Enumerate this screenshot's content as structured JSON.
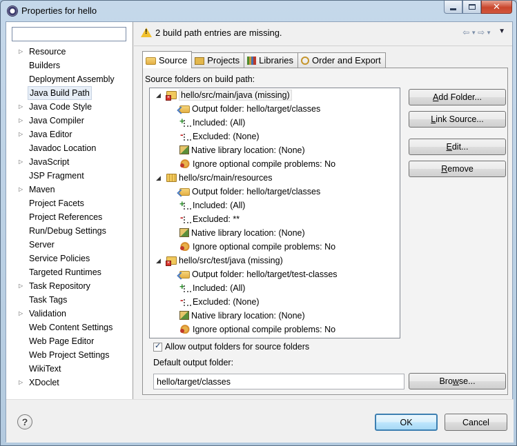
{
  "window": {
    "title": "Properties for hello",
    "buttons": {
      "minimize": "minimize",
      "maximize": "maximize",
      "close": "x"
    }
  },
  "sidebar": {
    "filter_placeholder": "",
    "items": [
      {
        "label": "Resource",
        "expandable": true
      },
      {
        "label": "Builders",
        "expandable": false
      },
      {
        "label": "Deployment Assembly",
        "expandable": false
      },
      {
        "label": "Java Build Path",
        "expandable": false,
        "selected": true
      },
      {
        "label": "Java Code Style",
        "expandable": true
      },
      {
        "label": "Java Compiler",
        "expandable": true
      },
      {
        "label": "Java Editor",
        "expandable": true
      },
      {
        "label": "Javadoc Location",
        "expandable": false
      },
      {
        "label": "JavaScript",
        "expandable": true
      },
      {
        "label": "JSP Fragment",
        "expandable": false
      },
      {
        "label": "Maven",
        "expandable": true
      },
      {
        "label": "Project Facets",
        "expandable": false
      },
      {
        "label": "Project References",
        "expandable": false
      },
      {
        "label": "Run/Debug Settings",
        "expandable": false
      },
      {
        "label": "Server",
        "expandable": false
      },
      {
        "label": "Service Policies",
        "expandable": false
      },
      {
        "label": "Targeted Runtimes",
        "expandable": false
      },
      {
        "label": "Task Repository",
        "expandable": true
      },
      {
        "label": "Task Tags",
        "expandable": false
      },
      {
        "label": "Validation",
        "expandable": true
      },
      {
        "label": "Web Content Settings",
        "expandable": false
      },
      {
        "label": "Web Page Editor",
        "expandable": false
      },
      {
        "label": "Web Project Settings",
        "expandable": false
      },
      {
        "label": "WikiText",
        "expandable": false
      },
      {
        "label": "XDoclet",
        "expandable": true
      }
    ]
  },
  "message": {
    "text": "2 build path entries are missing.",
    "icon": "warning-icon"
  },
  "tabs": [
    {
      "label": "Source",
      "icon": "source-folder-icon",
      "active": true
    },
    {
      "label": "Projects",
      "icon": "projects-icon",
      "active": false
    },
    {
      "label": "Libraries",
      "icon": "libraries-icon",
      "active": false
    },
    {
      "label": "Order and Export",
      "icon": "order-export-icon",
      "active": false
    }
  ],
  "source": {
    "label": "Source folders on build path:",
    "folders": [
      {
        "name": "hello/src/main/java (missing)",
        "missing": true,
        "children": [
          {
            "icon": "output-folder-icon",
            "text": "Output folder: hello/target/classes"
          },
          {
            "icon": "included-icon",
            "text": "Included: (All)"
          },
          {
            "icon": "excluded-icon",
            "text": "Excluded: (None)"
          },
          {
            "icon": "native-library-icon",
            "text": "Native library location: (None)"
          },
          {
            "icon": "ignore-problems-icon",
            "text": "Ignore optional compile problems: No"
          }
        ]
      },
      {
        "name": "hello/src/main/resources",
        "missing": false,
        "children": [
          {
            "icon": "output-folder-icon",
            "text": "Output folder: hello/target/classes"
          },
          {
            "icon": "included-icon",
            "text": "Included: (All)"
          },
          {
            "icon": "excluded-icon",
            "text": "Excluded: **"
          },
          {
            "icon": "native-library-icon",
            "text": "Native library location: (None)"
          },
          {
            "icon": "ignore-problems-icon",
            "text": "Ignore optional compile problems: No"
          }
        ]
      },
      {
        "name": "hello/src/test/java (missing)",
        "missing": true,
        "children": [
          {
            "icon": "output-folder-icon",
            "text": "Output folder: hello/target/test-classes"
          },
          {
            "icon": "included-icon",
            "text": "Included: (All)"
          },
          {
            "icon": "excluded-icon",
            "text": "Excluded: (None)"
          },
          {
            "icon": "native-library-icon",
            "text": "Native library location: (None)"
          },
          {
            "icon": "ignore-problems-icon",
            "text": "Ignore optional compile problems: No"
          }
        ]
      }
    ],
    "buttons": {
      "add_folder": {
        "pre": "",
        "key": "A",
        "post": "dd Folder..."
      },
      "link_source": {
        "pre": "",
        "key": "L",
        "post": "ink Source..."
      },
      "edit": {
        "pre": "",
        "key": "E",
        "post": "dit..."
      },
      "remove": {
        "pre": "",
        "key": "R",
        "post": "emove"
      }
    },
    "allow_output": {
      "label": "Allow output folders for source folders",
      "checked": true
    },
    "default_output": {
      "label": "Default output folder:",
      "value": "hello/target/classes"
    },
    "browse": {
      "pre": "Bro",
      "key": "w",
      "post": "se..."
    }
  },
  "footer": {
    "ok": "OK",
    "cancel": "Cancel"
  }
}
